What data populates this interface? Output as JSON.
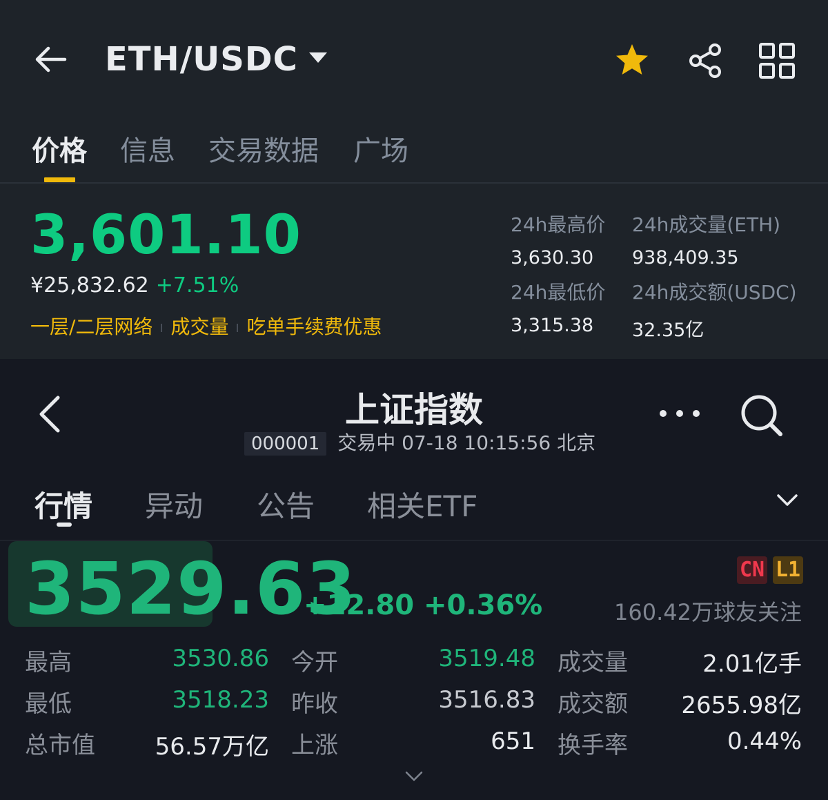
{
  "crypto": {
    "pair": "ETH/USDC",
    "tabs": [
      "价格",
      "信息",
      "交易数据",
      "广场"
    ],
    "price": "3,601.10",
    "price_cny": "¥25,832.62",
    "change_pct": "+7.51%",
    "tags": [
      "一层/二层网络",
      "成交量",
      "吃单手续费优惠"
    ],
    "stats": {
      "high_label": "24h最高价",
      "high_value": "3,630.30",
      "low_label": "24h最低价",
      "low_value": "3,315.38",
      "vol_eth_label": "24h成交量(ETH)",
      "vol_eth_value": "938,409.35",
      "vol_usdc_label": "24h成交额(USDC)",
      "vol_usdc_value": "32.35亿"
    },
    "colors": {
      "up": "#0ecb81",
      "accent": "#f0b90b"
    },
    "icons": [
      "back-arrow-icon",
      "dropdown-caret-icon",
      "star-icon",
      "share-icon",
      "grid-icon"
    ]
  },
  "index": {
    "title": "上证指数",
    "code": "000001",
    "status": "交易中 07-18 10:15:56 北京",
    "tabs": [
      "行情",
      "异动",
      "公告",
      "相关ETF"
    ],
    "price": "3529.63",
    "change": "+12.80 +0.36%",
    "badges": [
      "CN",
      "L1"
    ],
    "followers": "160.42万球友关注",
    "rows": [
      [
        {
          "label": "最高",
          "value": "3530.86"
        },
        {
          "label": "今开",
          "value": "3519.48"
        },
        {
          "label": "成交量",
          "value": "2.01亿手"
        }
      ],
      [
        {
          "label": "最低",
          "value": "3518.23"
        },
        {
          "label": "昨收",
          "value": "3516.83"
        },
        {
          "label": "成交额",
          "value": "2655.98亿"
        }
      ],
      [
        {
          "label": "总市值",
          "value": "56.57万亿"
        },
        {
          "label": "上涨",
          "value": "651"
        },
        {
          "label": "换手率",
          "value": "0.44%"
        }
      ]
    ],
    "colors": {
      "up": "#1fb57a",
      "cn_badge": "#f0384d",
      "l1_badge": "#f3b232"
    },
    "icons": [
      "back-chevron-icon",
      "more-dots-icon",
      "search-icon",
      "expand-chevron-icon",
      "collapse-chevron-icon"
    ]
  }
}
